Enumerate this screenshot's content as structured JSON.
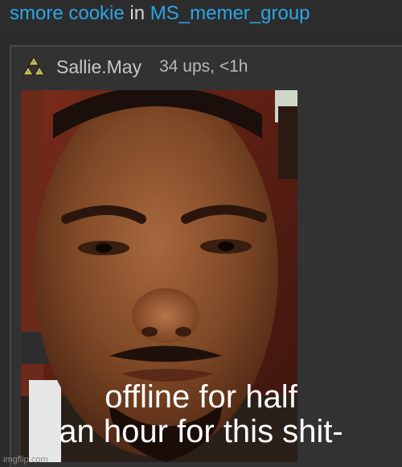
{
  "header": {
    "author": "smore cookie",
    "connector": "in",
    "group": "MS_memer_group"
  },
  "post": {
    "username": "Sallie.May",
    "meta": "34 ups, <1h",
    "icon": "triforce-badge-icon",
    "accent_color": "#2ca6e4"
  },
  "meme": {
    "caption_line1": "offline for half",
    "caption_line2": "an hour for this shit-",
    "watermark": "imgflip.com"
  }
}
